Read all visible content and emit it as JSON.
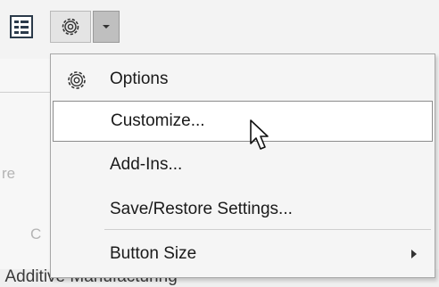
{
  "toolbar": {
    "list_icon": "list-icon",
    "gear_icon": "gear-icon",
    "dropdown_icon": "dropdown-arrow-icon"
  },
  "background": {
    "partial_left_text": "re",
    "partial_bottom_text": "C",
    "status_text": ": Additive Manufacturing"
  },
  "menu": {
    "items": [
      {
        "label": "Options",
        "icon": "gear-icon"
      },
      {
        "label": "Customize..."
      },
      {
        "label": "Add-Ins..."
      },
      {
        "label": "Save/Restore Settings..."
      },
      {
        "label": "Button Size",
        "submenu": true
      }
    ]
  },
  "colors": {
    "menu_bg": "#f5f5f5",
    "hover_bg": "#ffffff",
    "dropdown_btn": "#bfbfbf"
  }
}
